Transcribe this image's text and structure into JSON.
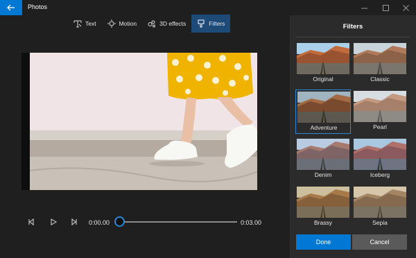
{
  "window": {
    "title": "Photos",
    "back_icon": "arrow-left-icon",
    "controls": [
      "minimize-icon",
      "maximize-icon",
      "close-icon"
    ]
  },
  "toolbar": {
    "items": [
      {
        "label": "Text",
        "icon": "text-icon"
      },
      {
        "label": "Motion",
        "icon": "motion-icon"
      },
      {
        "label": "3D effects",
        "icon": "3d-effects-icon"
      },
      {
        "label": "Filters",
        "icon": "filters-icon"
      }
    ],
    "active": "Filters"
  },
  "playback": {
    "current_time": "0:00.00",
    "end_time": "0:03.00",
    "progress": 0
  },
  "filters_panel": {
    "title": "Filters",
    "filters": [
      {
        "label": "Original",
        "selected": false
      },
      {
        "label": "Classic",
        "selected": false
      },
      {
        "label": "Adventure",
        "selected": true
      },
      {
        "label": "Pearl",
        "selected": false
      },
      {
        "label": "Denim",
        "selected": false
      },
      {
        "label": "Iceberg",
        "selected": false
      },
      {
        "label": "Brassy",
        "selected": false
      },
      {
        "label": "Sepia",
        "selected": false
      }
    ],
    "done_label": "Done",
    "cancel_label": "Cancel"
  },
  "colors": {
    "accent": "#0078d4",
    "active_tab": "#1e4a78",
    "panel_bg": "#2b2b2b",
    "app_bg": "#1f1f1f"
  }
}
